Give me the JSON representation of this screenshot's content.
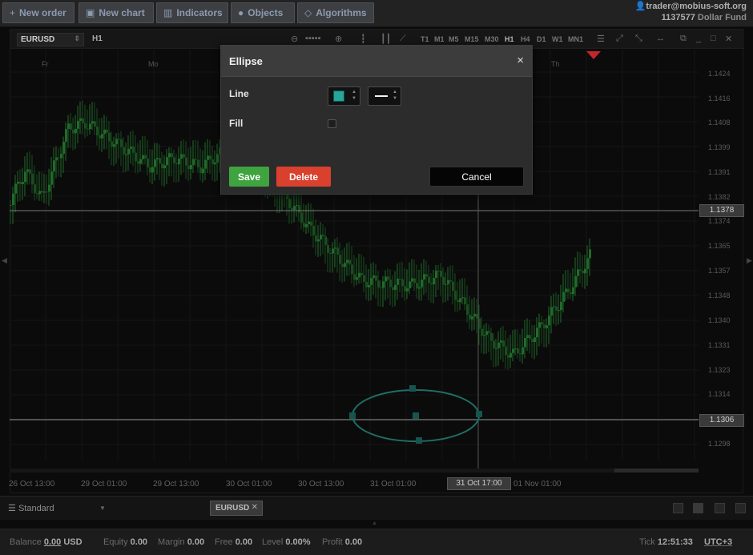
{
  "toolbar": {
    "new_order": "New order",
    "new_chart": "New chart",
    "indicators": "Indicators",
    "objects": "Objects",
    "algorithms": "Algorithms"
  },
  "account": {
    "user": "trader@mobius-soft.org",
    "id": "1137577",
    "fund": "Dollar Fund"
  },
  "chart": {
    "symbol": "EURUSD",
    "timeframe": "H1",
    "timeframes": [
      "T1",
      "M1",
      "M5",
      "M15",
      "M30",
      "H1",
      "H4",
      "D1",
      "W1",
      "MN1"
    ],
    "day_labels": [
      "Fr",
      "Mo",
      "Th"
    ],
    "price_labels": [
      "1.1424",
      "1.1416",
      "1.1408",
      "1.1399",
      "1.1391",
      "1.1382",
      "1.1374",
      "1.1365",
      "1.1357",
      "1.1348",
      "1.1340",
      "1.1331",
      "1.1323",
      "1.1314",
      "1.1298"
    ],
    "crosshair_price": "1.1378",
    "ellipse_price": "1.1306",
    "time_labels": [
      "26 Oct 13:00",
      "29 Oct 01:00",
      "29 Oct 13:00",
      "30 Oct 01:00",
      "30 Oct 13:00",
      "31 Oct 01:00",
      "01 Nov 01:00"
    ],
    "crosshair_time": "31 Oct 17:00",
    "colors": {
      "bull": "#1f6b2a",
      "bear": "#1a4d1f",
      "ellipse": "#1f6e66"
    }
  },
  "dialog": {
    "title": "Ellipse",
    "close": "×",
    "line_label": "Line",
    "fill_label": "Fill",
    "line_color": "#26a69a",
    "fill_checked": false,
    "save": "Save",
    "delete": "Delete",
    "cancel": "Cancel"
  },
  "bottom": {
    "layout": "Standard",
    "tab": "EURUSD"
  },
  "status": {
    "balance_label": "Balance",
    "balance": "0.00",
    "currency": "USD",
    "equity_label": "Equity",
    "equity": "0.00",
    "margin_label": "Margin",
    "margin": "0.00",
    "free_label": "Free",
    "free": "0.00",
    "level_label": "Level",
    "level": "0.00%",
    "profit_label": "Profit",
    "profit": "0.00",
    "tick_label": "Tick",
    "time": "12:51:33",
    "tz": "UTC+3"
  }
}
